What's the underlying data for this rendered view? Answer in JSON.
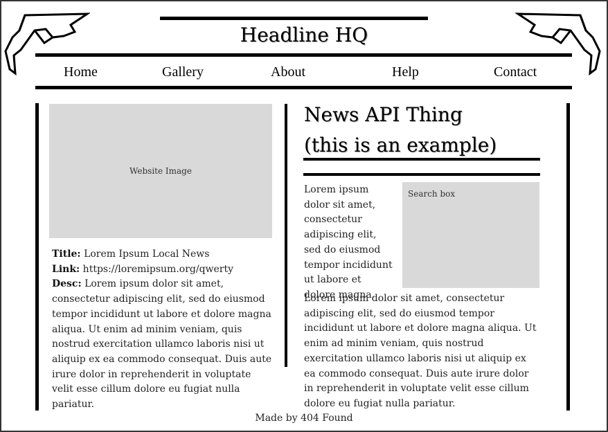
{
  "header": {
    "title": "Headline HQ"
  },
  "nav": {
    "items": [
      {
        "label": "Home"
      },
      {
        "label": "Gallery"
      },
      {
        "label": "About"
      },
      {
        "label": "Help"
      },
      {
        "label": "Contact"
      }
    ]
  },
  "left": {
    "image_label": "Website Image",
    "title_key": "Title:",
    "title_value": "Lorem Ipsum Local News",
    "link_key": "Link:",
    "link_value": "https://loremipsum.org/qwerty",
    "desc_key": "Desc:",
    "desc_value": "Lorem ipsum dolor sit amet, consectetur adipiscing elit, sed do eiusmod tempor incididunt ut labore et dolore magna aliqua. Ut enim ad minim veniam, quis nostrud exercitation ullamco laboris nisi ut aliquip ex ea commodo consequat. Duis aute irure dolor in reprehenderit in voluptate velit esse cillum dolore eu fugiat nulla pariatur."
  },
  "right": {
    "heading_line1": "News API Thing",
    "heading_line2": "(this is an example)",
    "search_label": "Search box",
    "short_text": "Lorem ipsum dolor sit amet, consectetur adipiscing elit, sed do eiusmod tempor incididunt ut labore et dolore magna.",
    "long_text": "Lorem ipsum dolor sit amet, consectetur adipiscing elit, sed do eiusmod tempor incididunt ut labore et dolore magna aliqua. Ut enim ad minim veniam, quis nostrud exercitation ullamco laboris nisi ut aliquip ex ea commodo consequat. Duis aute irure dolor in reprehenderit in voluptate velit esse cillum dolore eu fugiat nulla pariatur."
  },
  "footer": {
    "text": "Made by 404 Found"
  }
}
